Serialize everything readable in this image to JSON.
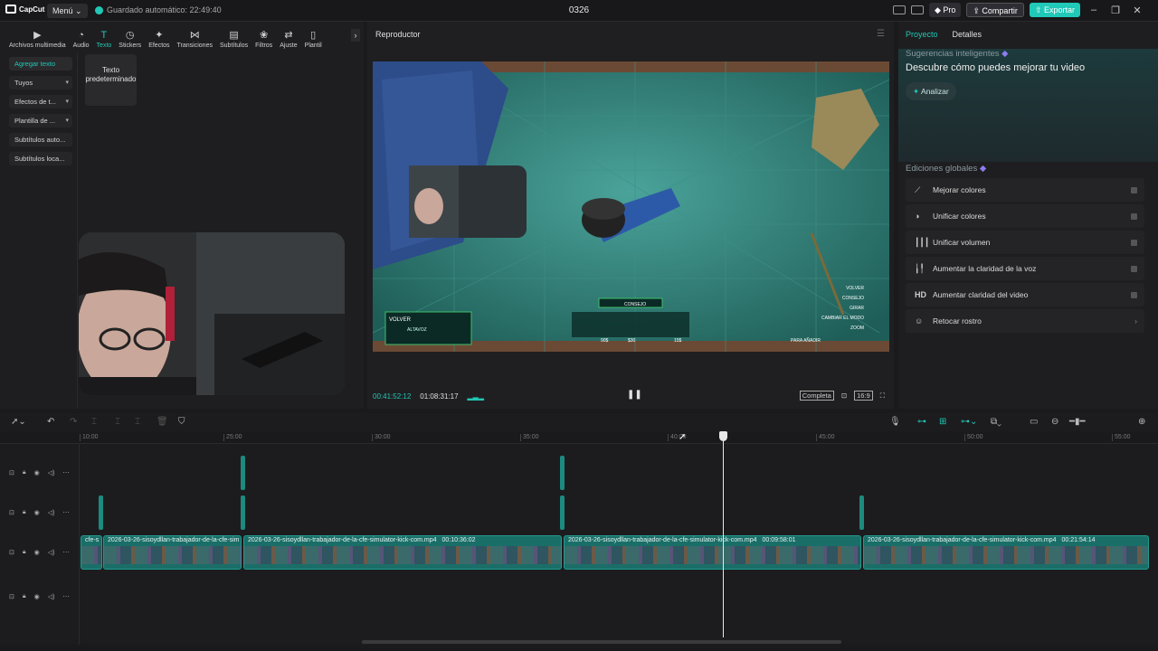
{
  "app": {
    "name": "CapCut",
    "menu_label": "Menú",
    "autosave": "Guardado automático: 22:49:40",
    "title": "0326",
    "pro_label": "Pro",
    "share_label": "Compartir",
    "export_label": "Exportar",
    "accent": "#21c7b5"
  },
  "tools": [
    {
      "label": "Archivos multimedia",
      "icon": "media-icon"
    },
    {
      "label": "Audio",
      "icon": "audio-icon"
    },
    {
      "label": "Texto",
      "icon": "text-icon"
    },
    {
      "label": "Stickers",
      "icon": "sticker-icon"
    },
    {
      "label": "Efectos",
      "icon": "effects-icon"
    },
    {
      "label": "Transiciones",
      "icon": "transition-icon"
    },
    {
      "label": "Subtítulos",
      "icon": "subtitle-icon"
    },
    {
      "label": "Filtros",
      "icon": "filter-icon"
    },
    {
      "label": "Ajuste",
      "icon": "adjust-icon"
    },
    {
      "label": "Plantil",
      "icon": "template-icon"
    }
  ],
  "text_nav": [
    "Agregar texto",
    "Tuyos",
    "Efectos de t...",
    "Plantilla de ...",
    "Subtítulos auto...",
    "Subtítulos loca..."
  ],
  "text_card": "Texto predeterminado",
  "player": {
    "title": "Reproductor",
    "current_time": "00:41:52:12",
    "total_time": "01:08:31:17",
    "mode_label": "Completa",
    "ratio_label": "16:9",
    "game_hud": {
      "volver": "VOLVER",
      "altavoz": "ALTAVOZ",
      "consejo": "CONSEJO",
      "price1": "90$",
      "price2": "$30",
      "price3": "15$",
      "menu": [
        "VOLVER",
        "CONSEJO",
        "GIRAR",
        "CAMBIAR EL MODO",
        "ZOOM",
        "PARA AÑADIR"
      ]
    }
  },
  "right_panel": {
    "tab_project": "Proyecto",
    "tab_details": "Detalles",
    "smart_label": "Sugerencias inteligentes",
    "smart_title": "Descubre cómo puedes mejorar tu video",
    "analyze": "Analizar",
    "global_label": "Ediciones globales",
    "items": [
      {
        "label": "Mejorar colores",
        "icon": "wand-icon"
      },
      {
        "label": "Unificar colores",
        "icon": "palette-icon"
      },
      {
        "label": "Unificar volumen",
        "icon": "volume-bars-icon"
      },
      {
        "label": "Aumentar la claridad de la voz",
        "icon": "voice-wave-icon"
      },
      {
        "label": "Aumentar claridad del video",
        "icon": "hd-icon"
      },
      {
        "label": "Retocar rostro",
        "icon": "face-icon"
      }
    ]
  },
  "ruler": [
    "10:00",
    "25:00",
    "30:00",
    "35:00",
    "40:00",
    "45:00",
    "50:00",
    "55:00"
  ],
  "clips": [
    {
      "title": "2026-03-26-sisoydllan-trabajador-de-la-cfe-sim",
      "duration": ""
    },
    {
      "title": "2026-03-26-sisoydllan-trabajador-de-la-cfe-simulator-kick-com.mp4",
      "duration": "00:10:36:02"
    },
    {
      "title": "2026-03-26-sisoydllan-trabajador-de-la-cfe-simulator-kick-com.mp4",
      "duration": "00:09:58:01"
    },
    {
      "title": "2026-03-26-sisoydllan-trabajador-de-la-cfe-simulator-kick-com.mp4",
      "duration": "00:21:54:14"
    }
  ],
  "first_clip_prefix": "cfe-s"
}
